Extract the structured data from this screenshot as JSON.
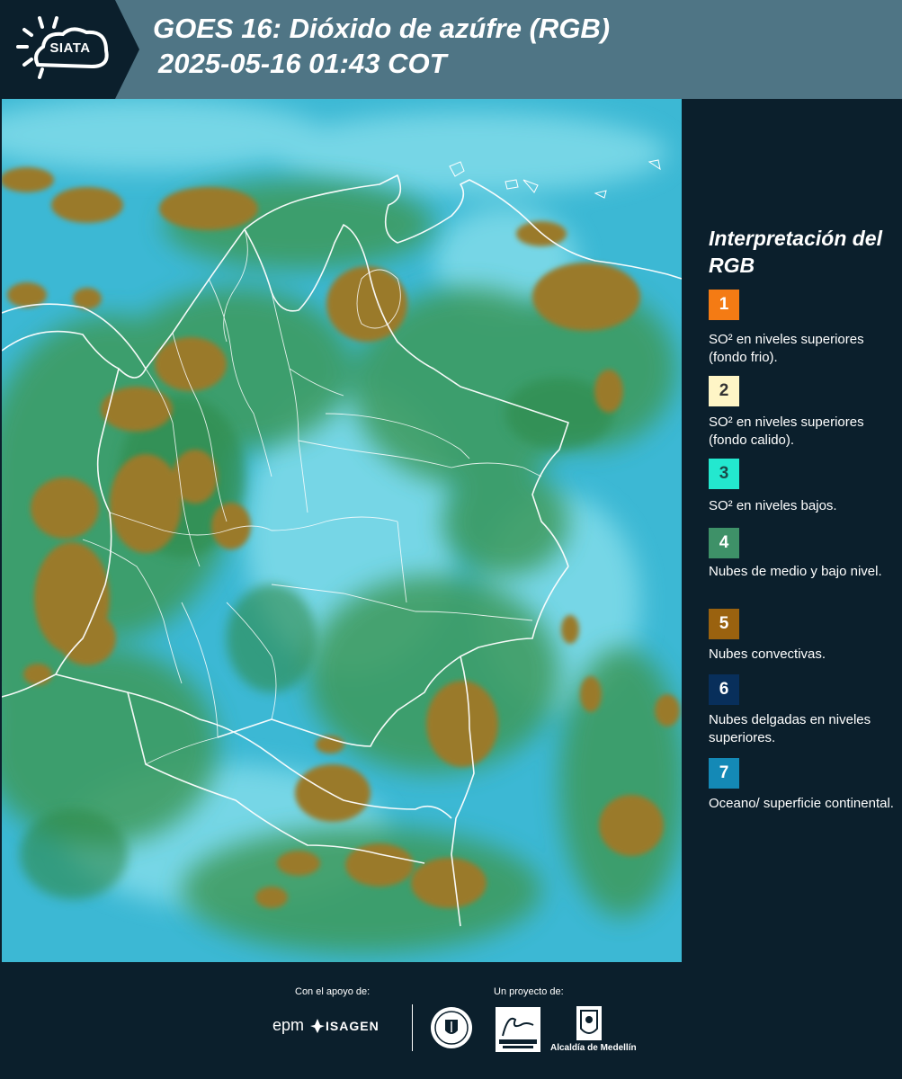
{
  "header": {
    "logo_text": "SIATA",
    "title_line1": "GOES 16: Dióxido de azúfre (RGB)",
    "title_line2": "2025-05-16 01:43 COT"
  },
  "legend": {
    "title": "Interpretación del RGB",
    "items": [
      {
        "number": "1",
        "color": "#f47b14",
        "text": "SO² en niveles superiores (fondo frio)."
      },
      {
        "number": "2",
        "color": "#fef5c6",
        "text": "SO² en niveles superiores (fondo calido)."
      },
      {
        "number": "3",
        "color": "#23e8cf",
        "text": "SO² en niveles bajos."
      },
      {
        "number": "4",
        "color": "#3e9168",
        "text": "Nubes de medio y bajo nivel."
      },
      {
        "number": "5",
        "color": "#9a620f",
        "text": "Nubes convectivas."
      },
      {
        "number": "6",
        "color": "#082f5b",
        "text": "Nubes delgadas en niveles superiores."
      },
      {
        "number": "7",
        "color": "#1489b6",
        "text": "Oceano/ superficie continental."
      }
    ]
  },
  "footer": {
    "support_caption": "Con el apoyo de:",
    "project_caption": "Un proyecto de:",
    "epm_logo": "epm",
    "isagen_logo": "ISAGEN",
    "alcaldia_logo": "Alcaldía de Medellín"
  },
  "colors": {
    "header_bg": "#4f7585",
    "panel_bg": "#0b1f2c",
    "map_base": "#3cb8d4",
    "cloud_green": "#3d9a5c",
    "convective": "#9a7a2c",
    "borders": "#ffffff"
  }
}
